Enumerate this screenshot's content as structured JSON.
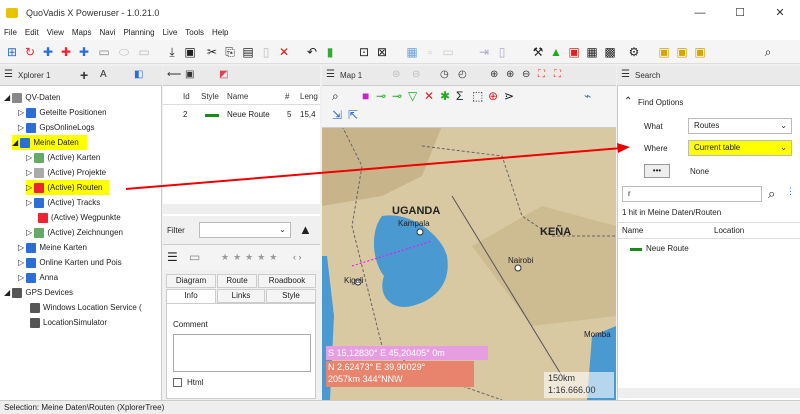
{
  "window": {
    "title": "QuoVadis X Poweruser - 1.0.21.0",
    "minimize": "—",
    "maximize": "☐",
    "close": "✕"
  },
  "menu": [
    "File",
    "Edit",
    "View",
    "Maps",
    "Navi",
    "Planning",
    "Live",
    "Tools",
    "Help"
  ],
  "xplorer": {
    "title": "Xplorer 1",
    "items": [
      {
        "label": "QV-Daten"
      },
      {
        "label": "Geteilte Positionen"
      },
      {
        "label": "GpsOnlineLogs"
      },
      {
        "label": "Meine Daten"
      },
      {
        "label": "(Active) Karten"
      },
      {
        "label": "(Active) Projekte"
      },
      {
        "label": "(Active) Routen"
      },
      {
        "label": "(Active) Tracks"
      },
      {
        "label": "(Active) Wegpunkte"
      },
      {
        "label": "(Active) Zeichnungen"
      },
      {
        "label": "Meine Karten"
      },
      {
        "label": "Online Karten und Pois"
      },
      {
        "label": "Anna"
      },
      {
        "label": "GPS Devices"
      },
      {
        "label": "Windows Location Service ("
      },
      {
        "label": "LocationSimulator"
      }
    ]
  },
  "table": {
    "headers": [
      "Id",
      "Style",
      "Name",
      "#",
      "Leng"
    ],
    "rows": [
      {
        "id": "2",
        "name": "Neue Route",
        "count": "5",
        "length": "15,4"
      }
    ]
  },
  "filter": {
    "label": "Filter"
  },
  "details": {
    "tabs_row1": [
      "Diagram",
      "Route",
      "Roadbook"
    ],
    "tabs_row2": [
      "Info",
      "Links",
      "Style"
    ],
    "comment_label": "Comment",
    "html_label": "Html"
  },
  "map": {
    "title": "Map 1",
    "labels": {
      "uganda": "UGANDA",
      "kampala": "Kampala",
      "kenya": "KEÑA",
      "nairobi": "Nairobi",
      "kigali": "Kigali",
      "mombasa": "Momba"
    },
    "coord1": "S 15,12830° E 45,20405° 0m",
    "coord2": "N 2,62473° E 39,90029°",
    "coord3": "2057km 344°NNW",
    "scale_km": "150km",
    "scale_ratio": "1:16.666.00"
  },
  "search": {
    "title": "Search",
    "find_options": "Find Options",
    "what_label": "What",
    "what_value": "Routes",
    "where_label": "Where",
    "where_value": "Current table",
    "more_button": "•••",
    "none_label": "None",
    "query": "r",
    "result_summary": "1 hit in Meine Daten/Routen",
    "col_name": "Name",
    "col_location": "Location",
    "results": [
      {
        "name": "Neue Route"
      }
    ]
  },
  "status": {
    "text": "Selection: Meine Daten\\Routen    (XplorerTree)"
  }
}
